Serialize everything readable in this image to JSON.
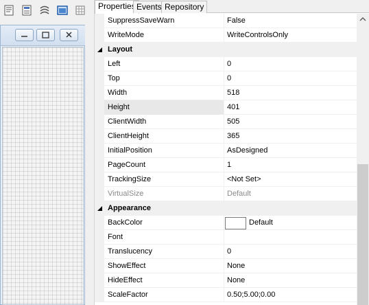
{
  "tabs": [
    {
      "label": "Properties"
    },
    {
      "label": "Events"
    },
    {
      "label": "Repository"
    }
  ],
  "toolbar": {
    "icons": [
      "properties-icon",
      "align-icon",
      "tab-order-icon",
      "form-icon",
      "grid-icon"
    ]
  },
  "rows": {
    "suppress_save_warn": {
      "name": "SuppressSaveWarn",
      "value": "False"
    },
    "write_mode": {
      "name": "WriteMode",
      "value": "WriteControlsOnly"
    },
    "layout_cat": {
      "label": "Layout"
    },
    "left": {
      "name": "Left",
      "value": "0"
    },
    "top": {
      "name": "Top",
      "value": "0"
    },
    "width": {
      "name": "Width",
      "value": "518"
    },
    "height": {
      "name": "Height",
      "value": "401"
    },
    "client_width": {
      "name": "ClientWidth",
      "value": "505"
    },
    "client_height": {
      "name": "ClientHeight",
      "value": "365"
    },
    "initial_position": {
      "name": "InitialPosition",
      "value": "AsDesigned"
    },
    "page_count": {
      "name": "PageCount",
      "value": "1"
    },
    "tracking_size": {
      "name": "TrackingSize",
      "value": "<Not Set>"
    },
    "virtual_size": {
      "name": "VirtualSize",
      "value": "Default"
    },
    "appearance_cat": {
      "label": "Appearance"
    },
    "back_color": {
      "name": "BackColor",
      "value": "Default"
    },
    "font": {
      "name": "Font",
      "value": ""
    },
    "translucency": {
      "name": "Translucency",
      "value": "0"
    },
    "show_effect": {
      "name": "ShowEffect",
      "value": "None"
    },
    "hide_effect": {
      "name": "HideEffect",
      "value": "None"
    },
    "scale_factor": {
      "name": "ScaleFactor",
      "value": "0.50;5.00;0.00"
    }
  },
  "colors": {
    "selected_row": "#e8e8e8",
    "category_bg": "#f0f0f0",
    "back_color_swatch": "#ffffff"
  }
}
